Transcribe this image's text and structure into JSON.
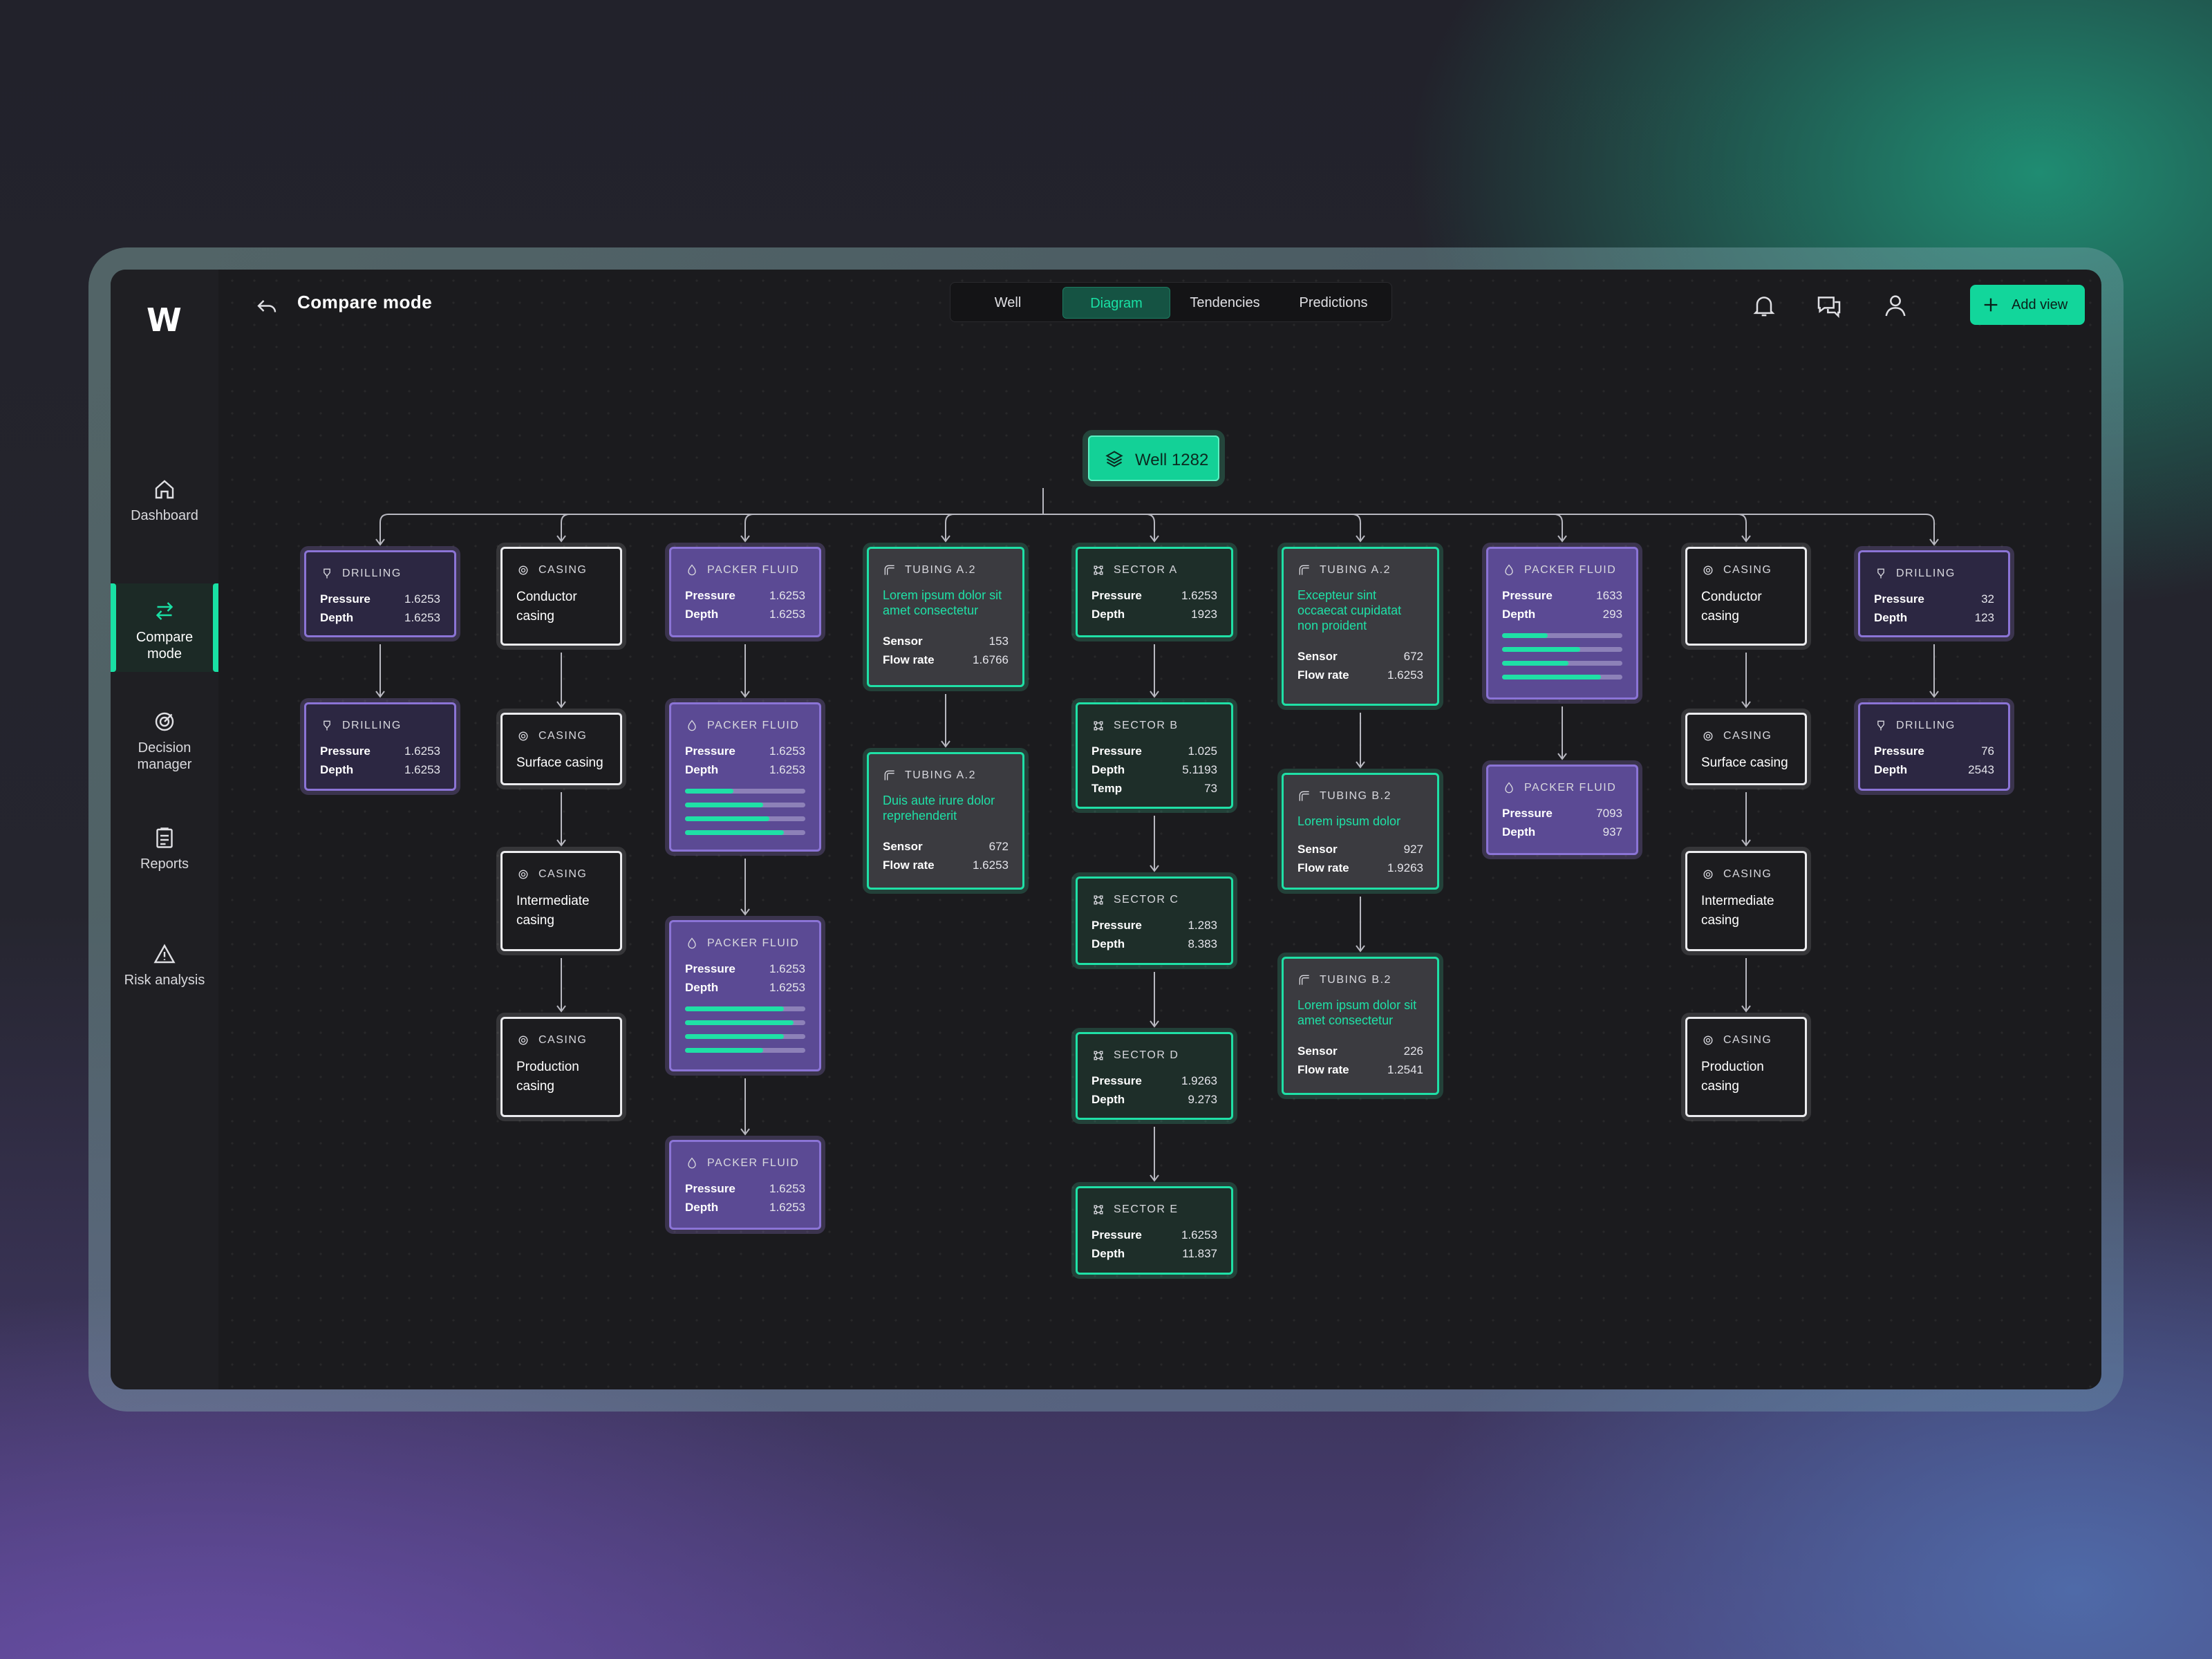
{
  "app": {
    "logo": "W",
    "title": "Compare mode"
  },
  "tabs": [
    {
      "label": "Well",
      "selected": false
    },
    {
      "label": "Diagram",
      "selected": true
    },
    {
      "label": "Tendencies",
      "selected": false
    },
    {
      "label": "Predictions",
      "selected": false
    }
  ],
  "add_button": "Add view",
  "nav": [
    {
      "label": "Dashboard",
      "icon": "home-icon"
    },
    {
      "label": "Compare mode",
      "icon": "compare-arrows-icon",
      "active": true
    },
    {
      "label": "Decision manager",
      "icon": "target-icon"
    },
    {
      "label": "Reports",
      "icon": "clipboard-icon"
    },
    {
      "label": "Risk analysis",
      "icon": "warning-icon"
    }
  ],
  "colors": {
    "accent": "#19e0a4",
    "purple": "#8b74d6",
    "background": "#1b1b1e"
  },
  "root": {
    "label": "Well 1282",
    "icon": "layers-icon"
  },
  "cards": [
    {
      "id": "c0",
      "col": 0,
      "kind": "drilling",
      "theme": "purple",
      "header": "DRILLING",
      "rows": [
        [
          "Pressure",
          "1.6253"
        ],
        [
          "Depth",
          "1.6253"
        ]
      ]
    },
    {
      "id": "c1",
      "col": 0,
      "kind": "drilling",
      "theme": "purple",
      "header": "DRILLING",
      "rows": [
        [
          "Pressure",
          "1.6253"
        ],
        [
          "Depth",
          "1.6253"
        ]
      ]
    },
    {
      "id": "c2",
      "col": 1,
      "kind": "casing",
      "theme": "white",
      "header": "CASING",
      "name": "Conductor casing"
    },
    {
      "id": "c3",
      "col": 1,
      "kind": "casing",
      "theme": "white",
      "header": "CASING",
      "name": "Surface casing"
    },
    {
      "id": "c4",
      "col": 1,
      "kind": "casing",
      "theme": "white",
      "header": "CASING",
      "name": "Intermediate casing"
    },
    {
      "id": "c5",
      "col": 1,
      "kind": "casing",
      "theme": "white",
      "header": "CASING",
      "name": "Production casing"
    },
    {
      "id": "c6",
      "col": 2,
      "kind": "packer",
      "theme": "purple fill",
      "header": "PACKER FLUID",
      "rows": [
        [
          "Pressure",
          "1.6253"
        ],
        [
          "Depth",
          "1.6253"
        ]
      ]
    },
    {
      "id": "c7",
      "col": 2,
      "kind": "packer",
      "theme": "purple fill",
      "header": "PACKER FLUID",
      "rows": [
        [
          "Pressure",
          "1.6253"
        ],
        [
          "Depth",
          "1.6253"
        ]
      ],
      "bars": [
        0.4,
        0.65,
        0.7,
        0.82
      ]
    },
    {
      "id": "c8",
      "col": 2,
      "kind": "packer",
      "theme": "purple fill",
      "header": "PACKER FLUID",
      "rows": [
        [
          "Pressure",
          "1.6253"
        ],
        [
          "Depth",
          "1.6253"
        ]
      ],
      "bars": [
        0.82,
        0.9,
        0.82,
        0.65
      ]
    },
    {
      "id": "c9",
      "col": 2,
      "kind": "packer",
      "theme": "purple fill",
      "header": "PACKER FLUID",
      "rows": [
        [
          "Pressure",
          "1.6253"
        ],
        [
          "Depth",
          "1.6253"
        ]
      ]
    },
    {
      "id": "c10",
      "col": 3,
      "kind": "tubing",
      "theme": "green",
      "header": "TUBING A.2",
      "desc": "Lorem ipsum dolor sit amet consectetur",
      "rows": [
        [
          "Sensor",
          "153"
        ],
        [
          "Flow rate",
          "1.6766"
        ]
      ]
    },
    {
      "id": "c11",
      "col": 3,
      "kind": "tubing",
      "theme": "green",
      "header": "TUBING A.2",
      "desc": "Duis aute irure dolor reprehenderit",
      "rows": [
        [
          "Sensor",
          "672"
        ],
        [
          "Flow rate",
          "1.6253"
        ]
      ]
    },
    {
      "id": "c12",
      "col": 4,
      "kind": "sector",
      "theme": "green greend",
      "header": "SECTOR A",
      "rows": [
        [
          "Pressure",
          "1.6253"
        ],
        [
          "Depth",
          "1923"
        ]
      ]
    },
    {
      "id": "c13",
      "col": 4,
      "kind": "sector",
      "theme": "green greend",
      "header": "SECTOR B",
      "rows": [
        [
          "Pressure",
          "1.025"
        ],
        [
          "Depth",
          "5.1193"
        ],
        [
          "Temp",
          "73"
        ]
      ]
    },
    {
      "id": "c14",
      "col": 4,
      "kind": "sector",
      "theme": "green greend",
      "header": "SECTOR C",
      "rows": [
        [
          "Pressure",
          "1.283"
        ],
        [
          "Depth",
          "8.383"
        ]
      ]
    },
    {
      "id": "c15",
      "col": 4,
      "kind": "sector",
      "theme": "green greend",
      "header": "SECTOR D",
      "rows": [
        [
          "Pressure",
          "1.9263"
        ],
        [
          "Depth",
          "9.273"
        ]
      ]
    },
    {
      "id": "c16",
      "col": 4,
      "kind": "sector",
      "theme": "green greend",
      "header": "SECTOR E",
      "rows": [
        [
          "Pressure",
          "1.6253"
        ],
        [
          "Depth",
          "11.837"
        ]
      ]
    },
    {
      "id": "c17",
      "col": 5,
      "kind": "tubing",
      "theme": "green",
      "header": "TUBING A.2",
      "desc": "Excepteur sint occaecat cupidatat non proident",
      "rows": [
        [
          "Sensor",
          "672"
        ],
        [
          "Flow rate",
          "1.6253"
        ]
      ]
    },
    {
      "id": "c18",
      "col": 5,
      "kind": "tubing",
      "theme": "green",
      "header": "TUBING B.2",
      "desc": "Lorem ipsum dolor",
      "rows": [
        [
          "Sensor",
          "927"
        ],
        [
          "Flow rate",
          "1.9263"
        ]
      ]
    },
    {
      "id": "c19",
      "col": 5,
      "kind": "tubing",
      "theme": "green",
      "header": "TUBING B.2",
      "desc": "Lorem ipsum dolor sit amet consectetur",
      "rows": [
        [
          "Sensor",
          "226"
        ],
        [
          "Flow rate",
          "1.2541"
        ]
      ]
    },
    {
      "id": "c20",
      "col": 6,
      "kind": "packer",
      "theme": "purple fill",
      "header": "PACKER FLUID",
      "rows": [
        [
          "Pressure",
          "1633"
        ],
        [
          "Depth",
          "293"
        ]
      ],
      "bars": [
        0.38,
        0.65,
        0.55,
        0.82
      ]
    },
    {
      "id": "c21",
      "col": 6,
      "kind": "packer",
      "theme": "purple fill",
      "header": "PACKER FLUID",
      "rows": [
        [
          "Pressure",
          "7093"
        ],
        [
          "Depth",
          "937"
        ]
      ]
    },
    {
      "id": "c22",
      "col": 7,
      "kind": "casing",
      "theme": "white",
      "header": "CASING",
      "name": "Conductor casing"
    },
    {
      "id": "c23",
      "col": 7,
      "kind": "casing",
      "theme": "white",
      "header": "CASING",
      "name": "Surface casing"
    },
    {
      "id": "c24",
      "col": 7,
      "kind": "casing",
      "theme": "white",
      "header": "CASING",
      "name": "Intermediate casing"
    },
    {
      "id": "c25",
      "col": 7,
      "kind": "casing",
      "theme": "white",
      "header": "CASING",
      "name": "Production casing"
    },
    {
      "id": "c26",
      "col": 8,
      "kind": "drilling",
      "theme": "purple",
      "header": "DRILLING",
      "rows": [
        [
          "Pressure",
          "32"
        ],
        [
          "Depth",
          "123"
        ]
      ]
    },
    {
      "id": "c27",
      "col": 8,
      "kind": "drilling",
      "theme": "purple",
      "header": "DRILLING",
      "rows": [
        [
          "Pressure",
          "76"
        ],
        [
          "Depth",
          "2543"
        ]
      ]
    }
  ]
}
